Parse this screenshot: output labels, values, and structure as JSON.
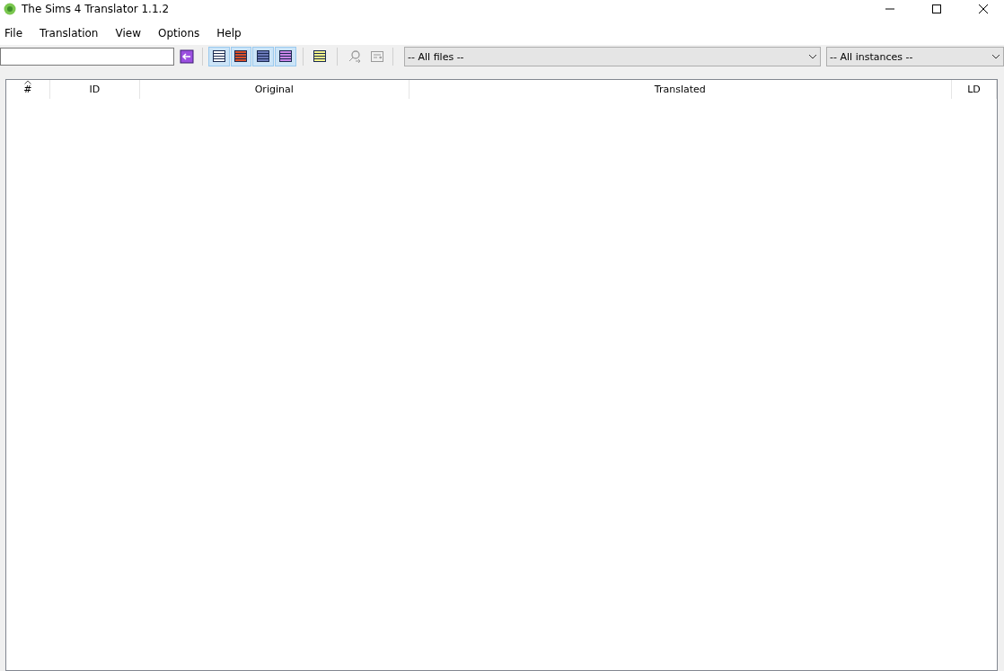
{
  "window": {
    "title": "The Sims 4 Translator 1.1.2"
  },
  "menu": [
    "File",
    "Translation",
    "View",
    "Options",
    "Help"
  ],
  "toolbar": {
    "filter_buttons": [
      {
        "color": "#ffffff",
        "selected": true
      },
      {
        "color": "#d9502a",
        "selected": true
      },
      {
        "color": "#6a78b8",
        "selected": true
      },
      {
        "color": "#c784e6",
        "selected": true
      },
      {
        "color": "#f4f48a",
        "selected": false
      }
    ],
    "tools": [
      {
        "kind": "find",
        "disabled": true
      },
      {
        "kind": "replace",
        "disabled": true
      }
    ],
    "files_dropdown": "-- All files --",
    "instances_dropdown": "-- All instances --"
  },
  "table": {
    "columns": [
      {
        "label": "#",
        "sorted": true
      },
      {
        "label": "ID",
        "sorted": false
      },
      {
        "label": "Original",
        "sorted": false
      },
      {
        "label": "Translated",
        "sorted": false
      },
      {
        "label": "LD",
        "sorted": false
      }
    ]
  }
}
